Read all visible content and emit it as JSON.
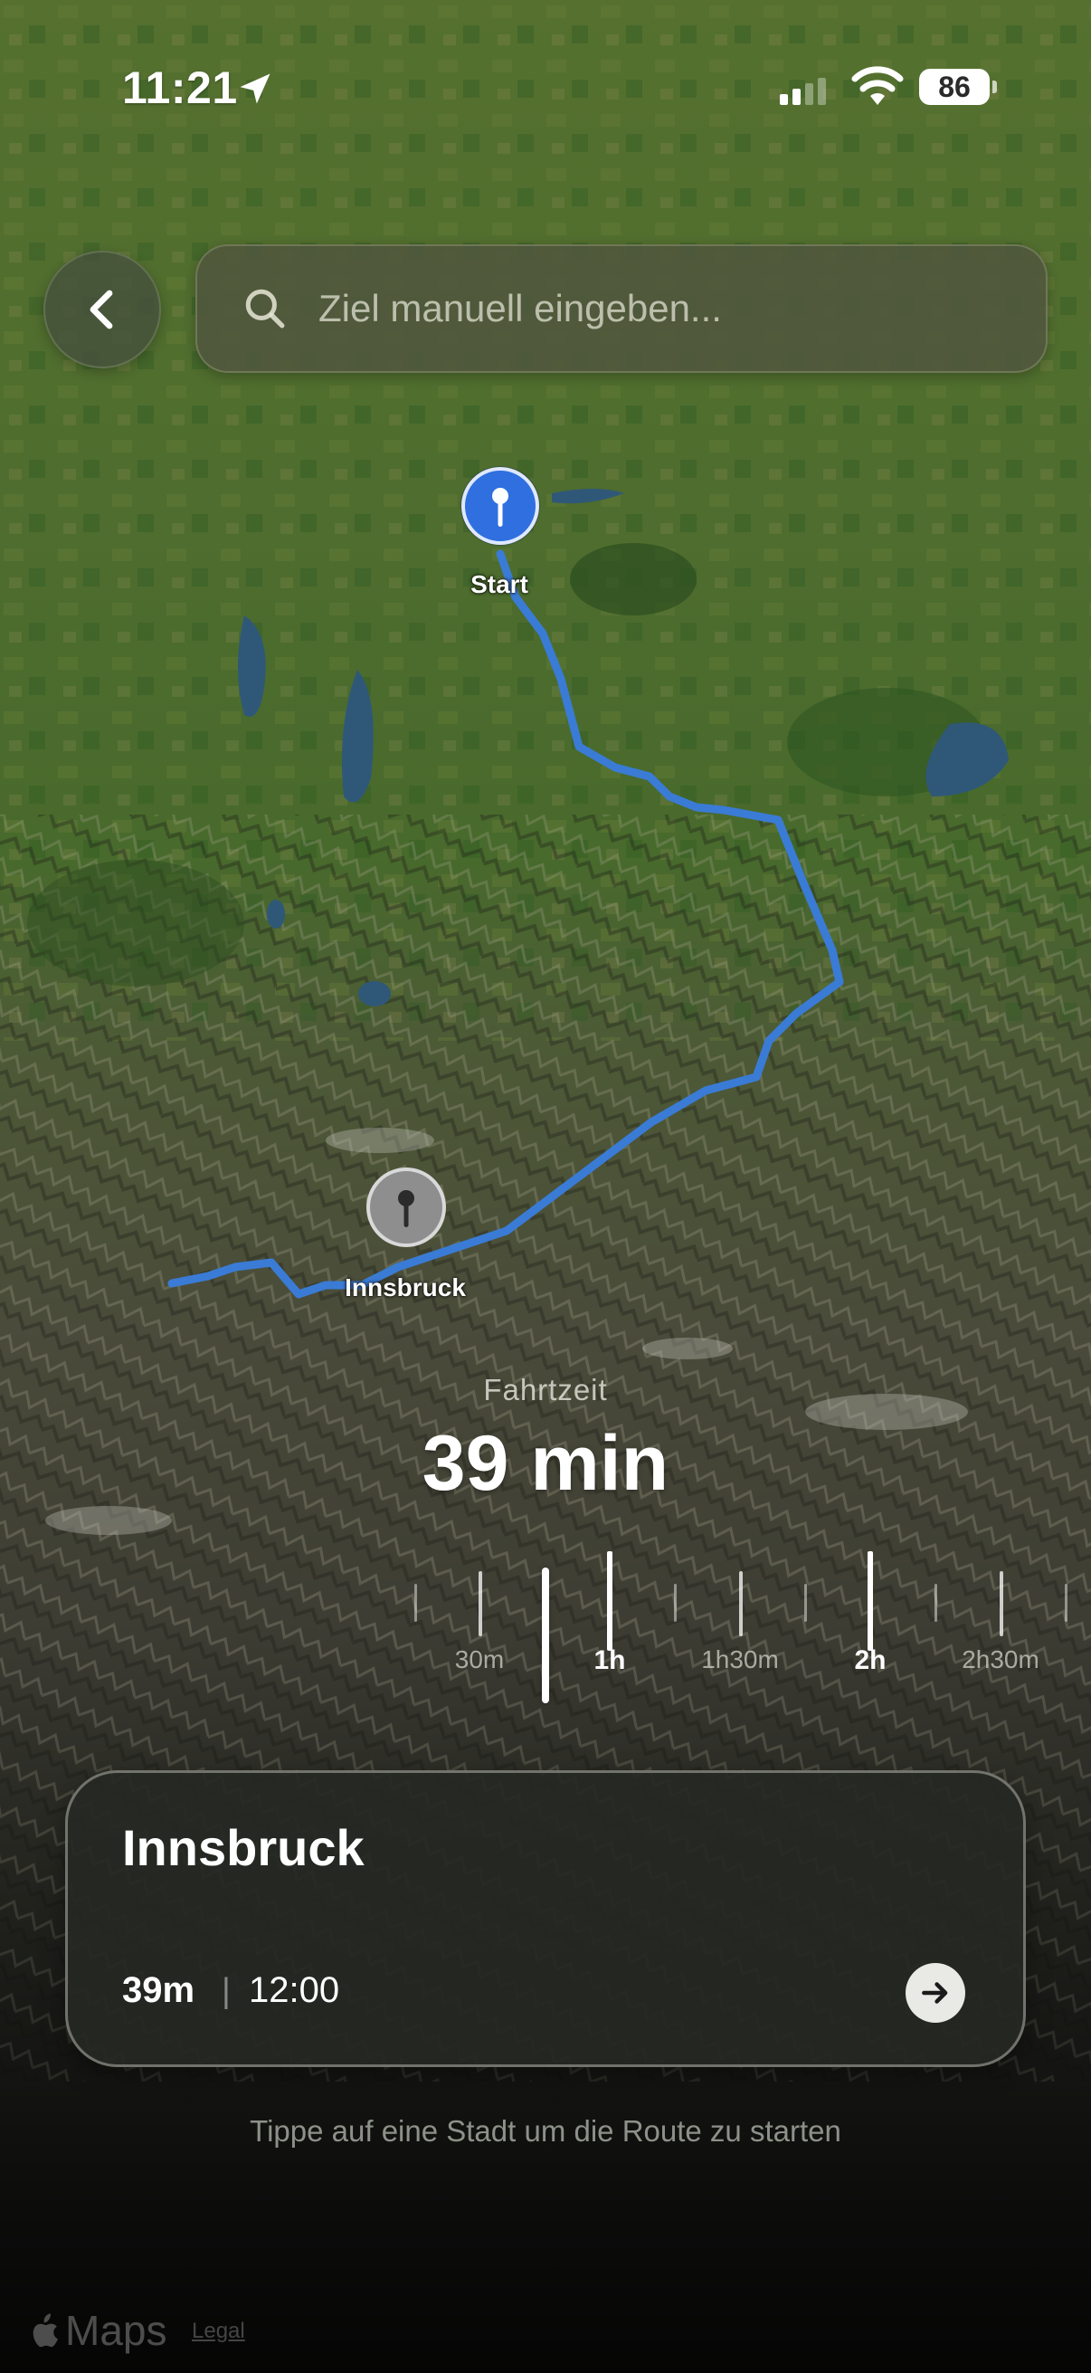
{
  "status_bar": {
    "time": "11:21",
    "battery": "86"
  },
  "search": {
    "placeholder": "Ziel manuell eingeben..."
  },
  "map": {
    "start_label": "Start",
    "destination_label": "Innsbruck",
    "route_color": "#3a7bd5",
    "start_pin_color": "#2f6fe0",
    "destination_pin_color": "#8e8e8e"
  },
  "travel_time": {
    "label": "Fahrtzeit",
    "value": "39 min"
  },
  "slider": {
    "labels": [
      "30m",
      "1h",
      "1h30m",
      "2h",
      "2h30m"
    ],
    "selected_minutes": 39
  },
  "destination_card": {
    "title": "Innsbruck",
    "duration": "39m",
    "separator": "|",
    "arrival": "12:00"
  },
  "hint": "Tippe auf eine Stadt um die Route zu starten",
  "footer": {
    "logo": "Maps",
    "legal": "Legal"
  }
}
